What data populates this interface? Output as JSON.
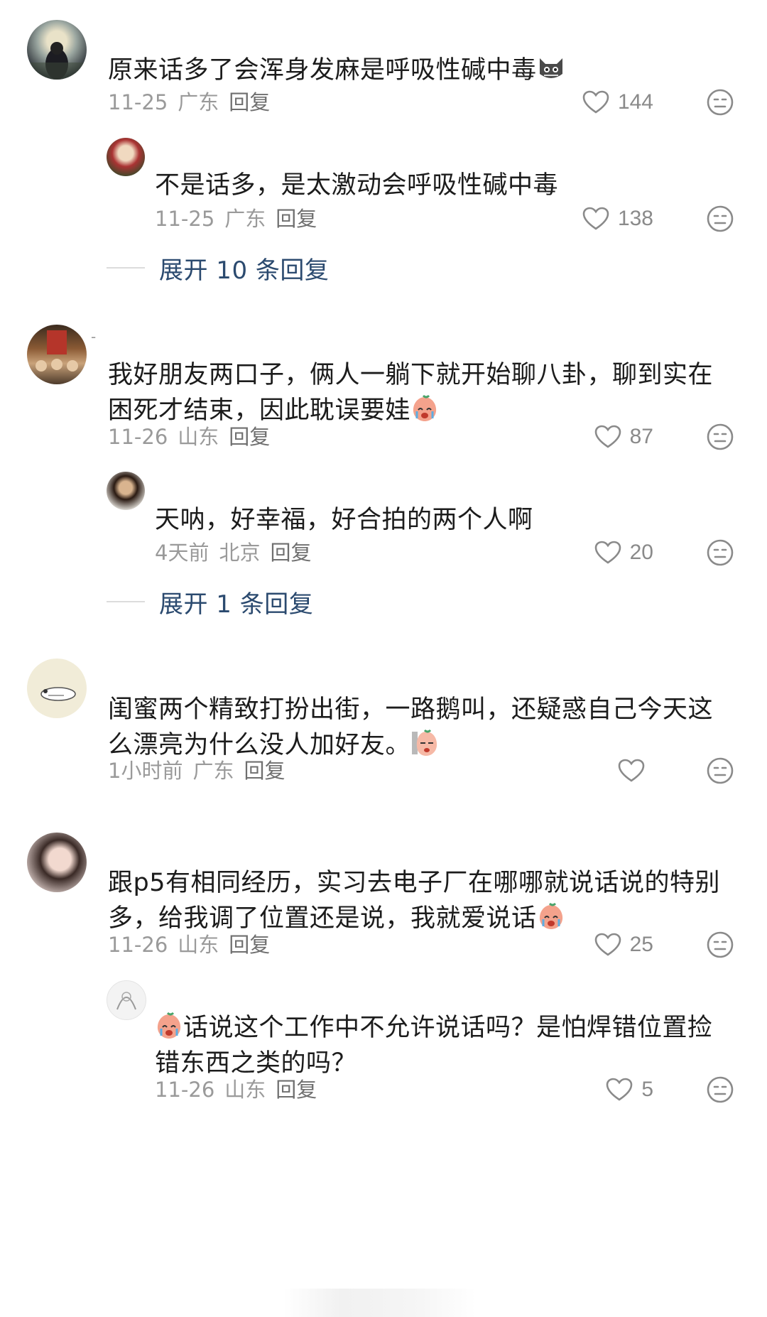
{
  "comments": [
    {
      "text": "原来话多了会浑身发麻是呼吸性碱中毒",
      "date": "11-25",
      "location": "广东",
      "reply_label": "回复",
      "likes": "144",
      "replies": [
        {
          "text": "不是话多，是太激动会呼吸性碱中毒",
          "date": "11-25",
          "location": "广东",
          "reply_label": "回复",
          "likes": "138"
        }
      ],
      "expand_label": "展开 10 条回复"
    },
    {
      "text_line1": "我好朋友两口子，俩人一躺下就开始聊八卦，聊到实在",
      "text_line2": "困死才结束，因此耽误要娃",
      "date": "11-26",
      "location": "山东",
      "reply_label": "回复",
      "likes": "87",
      "replies": [
        {
          "text": "天呐，好幸福，好合拍的两个人啊",
          "date": "4天前",
          "location": "北京",
          "reply_label": "回复",
          "likes": "20"
        }
      ],
      "expand_label": "展开 1 条回复"
    },
    {
      "text_line1": "闺蜜两个精致打扮出街，一路鹅叫，还疑惑自己今天这",
      "text_line2": "么漂亮为什么没人加好友。",
      "date": "1小时前",
      "location": "广东",
      "reply_label": "回复",
      "likes": ""
    },
    {
      "text_line1": "跟p5有相同经历，实习去电子厂在哪哪就说话说的特别",
      "text_line2": "多，给我调了位置还是说，我就爱说话",
      "date": "11-26",
      "location": "山东",
      "reply_label": "回复",
      "likes": "25",
      "replies": [
        {
          "text_line1": "话说这个工作中不允许说话吗？是怕焊错位置捡",
          "text_line2": "错东西之类的吗？",
          "date": "11-26",
          "location": "山东",
          "reply_label": "回复",
          "likes": "5"
        }
      ]
    }
  ],
  "colors": {
    "text": "#1c1c1c",
    "meta": "#9a9a9a",
    "expand": "#2b4a6f",
    "icon": "#8a8a8a"
  }
}
